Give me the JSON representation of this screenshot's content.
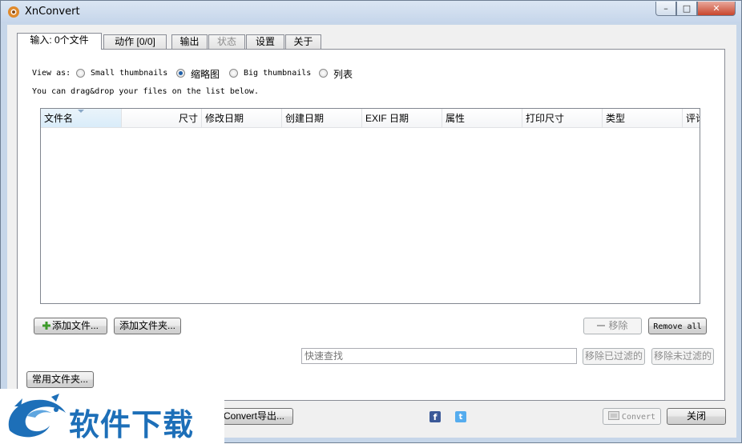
{
  "window": {
    "title": "XnConvert",
    "controls": {
      "minimize": "–",
      "maximize": "□",
      "close": "✕"
    }
  },
  "tabs": [
    {
      "label": "输入: 0个文件",
      "state": "active"
    },
    {
      "label": "动作 [0/0]",
      "state": "normal"
    },
    {
      "label": "输出",
      "state": "normal"
    },
    {
      "label": "状态",
      "state": "disabled"
    },
    {
      "label": "设置",
      "state": "normal"
    },
    {
      "label": "关于",
      "state": "normal"
    }
  ],
  "input_panel": {
    "view_as_label": "View as:",
    "view_options": [
      {
        "label": "Small thumbnails",
        "checked": false
      },
      {
        "label": "缩略图",
        "checked": true
      },
      {
        "label": "Big thumbnails",
        "checked": false
      },
      {
        "label": "列表",
        "checked": false
      }
    ],
    "hint": "You can drag&drop your files on the list below.",
    "columns": [
      "文件名",
      "尺寸",
      "修改日期",
      "创建日期",
      "EXIF 日期",
      "属性",
      "打印尺寸",
      "类型",
      "评论"
    ],
    "buttons": {
      "add_files": "添加文件...",
      "add_folder": "添加文件夹...",
      "remove": "移除",
      "remove_all": "Remove all",
      "remove_filtered": "移除已过滤的",
      "remove_unfiltered": "移除未过滤的"
    },
    "search_placeholder": "快速查找"
  },
  "footer": {
    "common_folders": "常用文件夹...",
    "export": "Convert导出...",
    "convert": "Convert",
    "close": "关闭"
  },
  "social": {
    "facebook": "f",
    "twitter": "t"
  },
  "watermark": {
    "text": "软件下载"
  },
  "colors": {
    "accent": "#1f5fa8",
    "titlebar": "#c5d5ea",
    "facebook": "#3b5998",
    "twitter": "#55acee",
    "watermark": "#1d6fb8"
  }
}
